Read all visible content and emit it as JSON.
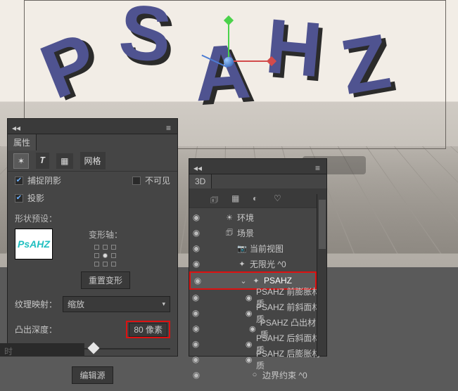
{
  "viewport": {
    "letters": [
      "P",
      "S",
      "A",
      "H",
      "Z"
    ]
  },
  "props": {
    "title": "属性",
    "tabs_icons": [
      "brush",
      "T",
      "grid",
      "mesh"
    ],
    "tab_mesh": "网格",
    "capture_shadow": "捕捉阴影",
    "cast_shadow": "投影",
    "invisible": "不可见",
    "shape_preset": "形状预设：",
    "deform_axis": "变形轴：",
    "reset_deform": "重置变形",
    "texture_map": "纹理映射：",
    "texture_value": "缩放",
    "extrude_depth": "凸出深度：",
    "extrude_value": "80 像素",
    "edit_source": "编辑源",
    "thumb_text": "PsAHZ"
  },
  "panel3d": {
    "title": "3D",
    "tree": [
      {
        "d": 0,
        "i": "env",
        "l": "环境"
      },
      {
        "d": 0,
        "i": "scene",
        "l": "场景"
      },
      {
        "d": 1,
        "i": "cam",
        "l": "当前视图"
      },
      {
        "d": 1,
        "i": "light",
        "l": "无限光  ^0"
      },
      {
        "d": 1,
        "i": "mesh",
        "l": "PSAHZ",
        "sel": true,
        "chev": true
      },
      {
        "d": 2,
        "i": "mat",
        "l": "PSAHZ 前膨胀材质"
      },
      {
        "d": 2,
        "i": "mat",
        "l": "PSAHZ 前斜面材质"
      },
      {
        "d": 2,
        "i": "mat",
        "l": "PSAHZ 凸出材质"
      },
      {
        "d": 2,
        "i": "mat",
        "l": "PSAHZ 后斜面材质"
      },
      {
        "d": 2,
        "i": "mat",
        "l": "PSAHZ 后膨胀材质"
      },
      {
        "d": 2,
        "i": "edge",
        "l": "边界约束 ^0"
      }
    ]
  },
  "left_label": "时"
}
